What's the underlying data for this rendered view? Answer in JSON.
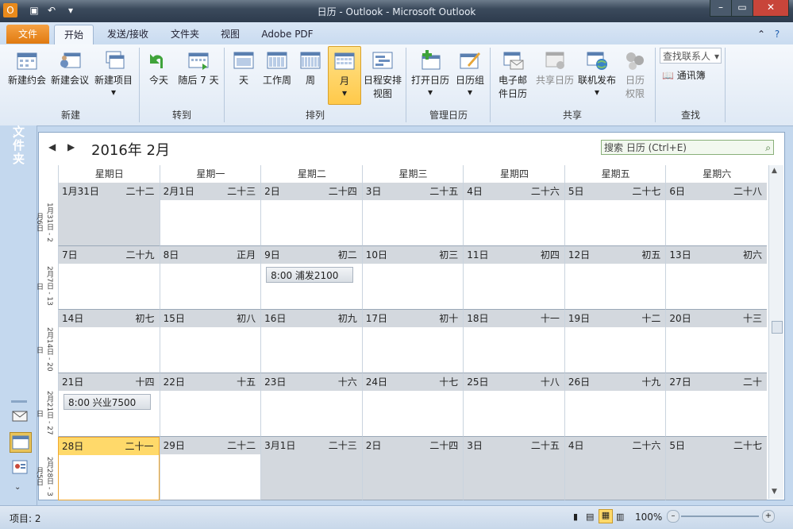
{
  "window": {
    "title": "日历 - Outlook - Microsoft Outlook"
  },
  "tabs": [
    {
      "label": "文件"
    },
    {
      "label": "开始"
    },
    {
      "label": "发送/接收"
    },
    {
      "label": "文件夹"
    },
    {
      "label": "视图"
    },
    {
      "label": "Adobe PDF"
    }
  ],
  "ribbon": {
    "buttons": {
      "new_appt": "新建约会",
      "new_meeting": "新建会议",
      "new_items": "新建项目",
      "today": "今天",
      "next7": "随后 7 天",
      "day": "天",
      "workweek": "工作周",
      "week": "周",
      "month": "月",
      "schedule": "日程安排视图",
      "open_cal": "打开日历",
      "cal_group": "日历组",
      "email_cal": "电子邮件日历",
      "share_cal": "共享日历",
      "publish": "联机发布",
      "cal_perm": "日历权限",
      "find_contact": "查找联系人",
      "addr_book": "通讯簿"
    },
    "groups": {
      "new": "新建",
      "goto": "转到",
      "arrange": "排列",
      "manage": "管理日历",
      "share": "共享",
      "find": "查找"
    }
  },
  "leftnav": {
    "folder_label": "文件夹"
  },
  "calendar": {
    "month_title": "2016年 2月",
    "search_placeholder": "搜索 日历 (Ctrl+E)",
    "weekdays": [
      "星期日",
      "星期一",
      "星期二",
      "星期三",
      "星期四",
      "星期五",
      "星期六"
    ],
    "week_labels": [
      "1月31日 - 2月6日",
      "2月7日 - 13日",
      "2月14日 - 20日",
      "2月21日 - 27日",
      "2月28日 - 3月5日"
    ],
    "weeks": [
      [
        {
          "d": "1月31日",
          "l": "二十二",
          "other": true
        },
        {
          "d": "2月1日",
          "l": "二十三"
        },
        {
          "d": "2日",
          "l": "二十四"
        },
        {
          "d": "3日",
          "l": "二十五"
        },
        {
          "d": "4日",
          "l": "二十六"
        },
        {
          "d": "5日",
          "l": "二十七"
        },
        {
          "d": "6日",
          "l": "二十八"
        }
      ],
      [
        {
          "d": "7日",
          "l": "二十九"
        },
        {
          "d": "8日",
          "l": "正月"
        },
        {
          "d": "9日",
          "l": "初二",
          "appt": "8:00  浦发2100"
        },
        {
          "d": "10日",
          "l": "初三"
        },
        {
          "d": "11日",
          "l": "初四"
        },
        {
          "d": "12日",
          "l": "初五"
        },
        {
          "d": "13日",
          "l": "初六"
        }
      ],
      [
        {
          "d": "14日",
          "l": "初七"
        },
        {
          "d": "15日",
          "l": "初八"
        },
        {
          "d": "16日",
          "l": "初九"
        },
        {
          "d": "17日",
          "l": "初十"
        },
        {
          "d": "18日",
          "l": "十一"
        },
        {
          "d": "19日",
          "l": "十二"
        },
        {
          "d": "20日",
          "l": "十三"
        }
      ],
      [
        {
          "d": "21日",
          "l": "十四",
          "appt": "8:00  兴业7500"
        },
        {
          "d": "22日",
          "l": "十五"
        },
        {
          "d": "23日",
          "l": "十六"
        },
        {
          "d": "24日",
          "l": "十七"
        },
        {
          "d": "25日",
          "l": "十八"
        },
        {
          "d": "26日",
          "l": "十九"
        },
        {
          "d": "27日",
          "l": "二十"
        }
      ],
      [
        {
          "d": "28日",
          "l": "二十一",
          "today": true
        },
        {
          "d": "29日",
          "l": "二十二"
        },
        {
          "d": "3月1日",
          "l": "二十三",
          "other": true
        },
        {
          "d": "2日",
          "l": "二十四",
          "other": true
        },
        {
          "d": "3日",
          "l": "二十五",
          "other": true
        },
        {
          "d": "4日",
          "l": "二十六",
          "other": true
        },
        {
          "d": "5日",
          "l": "二十七",
          "other": true
        }
      ]
    ]
  },
  "status": {
    "items": "项目: 2",
    "zoom": "100%"
  }
}
